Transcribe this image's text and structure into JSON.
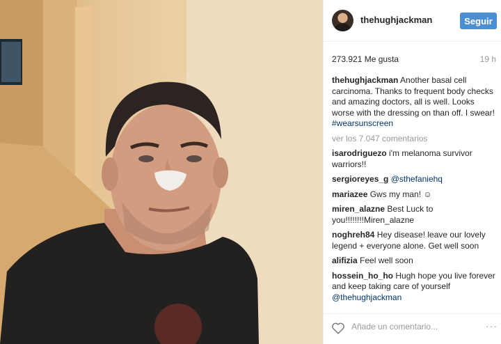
{
  "post": {
    "username": "thehughjackman",
    "follow_label": "Seguir",
    "likes": "273.921 Me gusta",
    "time_ago": "19 h",
    "caption": {
      "user": "thehughjackman",
      "text": "Another basal cell carcinoma. Thanks to frequent body checks and amazing doctors, all is well. Looks worse with the dressing on than off. I swear!",
      "hashtag": "#wearsunscreen"
    },
    "view_all_label": "ver los 7.047 comentarios",
    "comments": [
      {
        "user": "isarodriguezo",
        "text": "i'm melanoma survivor warriors!!"
      },
      {
        "user": "sergioreyes_g",
        "text": "@sthefaniehq"
      },
      {
        "user": "mariazee",
        "text": "Gws my man! ☺"
      },
      {
        "user": "miren_alazne",
        "text": "Best Luck to you!!!!!!!!Miren_alazne"
      },
      {
        "user": "noghreh84",
        "text": "Hey disease! leave our lovely legend + everyone alone. Get well soon"
      },
      {
        "user": "alifizia",
        "text": "Feel well soon"
      },
      {
        "user": "hossein_ho_ho",
        "text": "Hugh hope you live forever and keep taking care of yourself"
      }
    ],
    "last_mention": "@thehughjackman",
    "add_comment_placeholder": "Añade un comentario...",
    "more_label": "···"
  },
  "icons": {
    "like": "heart-icon",
    "more": "more-options-icon"
  },
  "colors": {
    "follow": "#4a8fd4",
    "link": "#003569",
    "muted": "#999999"
  }
}
